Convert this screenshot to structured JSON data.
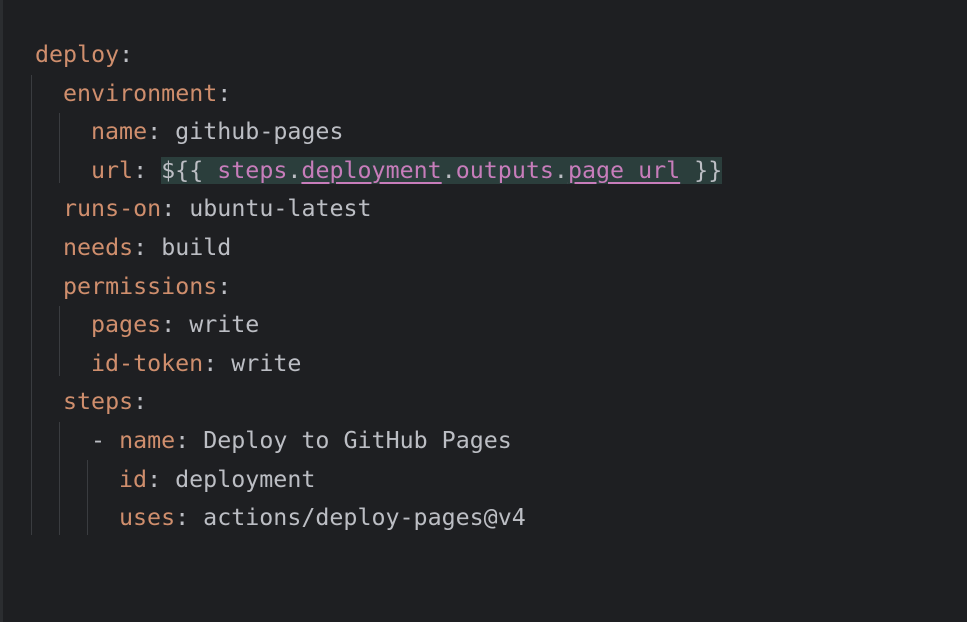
{
  "lines": [
    {
      "indent": 0,
      "key": "deploy",
      "colon": ":",
      "value": ""
    },
    {
      "indent": 1,
      "key": "environment",
      "colon": ":",
      "value": ""
    },
    {
      "indent": 2,
      "key": "name",
      "colon": ":",
      "value": " github-pages"
    },
    {
      "indent": 2,
      "key": "url",
      "colon": ":",
      "value": ""
    },
    {
      "indent": 1,
      "key": "runs-on",
      "colon": ":",
      "value": " ubuntu-latest"
    },
    {
      "indent": 1,
      "key": "needs",
      "colon": ":",
      "value": " build"
    },
    {
      "indent": 1,
      "key": "permissions",
      "colon": ":",
      "value": ""
    },
    {
      "indent": 2,
      "key": "pages",
      "colon": ":",
      "value": " write"
    },
    {
      "indent": 2,
      "key": "id-token",
      "colon": ":",
      "value": " write"
    },
    {
      "indent": 1,
      "key": "steps",
      "colon": ":",
      "value": ""
    },
    {
      "indent": 2,
      "dash": "- ",
      "key": "name",
      "colon": ":",
      "value": " Deploy to GitHub Pages"
    },
    {
      "indent": 3,
      "key": "id",
      "colon": ":",
      "value": " deployment"
    },
    {
      "indent": 3,
      "key": "uses",
      "colon": ":",
      "value": " actions/deploy-pages@v4"
    }
  ],
  "url_expr": {
    "open": "${{ ",
    "steps": "steps",
    "dot1": ".",
    "deployment": "deployment",
    "dot2": ".",
    "outputs": "outputs",
    "dot3": ".",
    "page_url": "page_url",
    "close": " }}"
  },
  "colors": {
    "background": "#1e1f22",
    "key": "#cf8e6d",
    "text": "#bcbec4",
    "identifier": "#c77dbb",
    "expression_highlight": "#2b3e3c"
  }
}
